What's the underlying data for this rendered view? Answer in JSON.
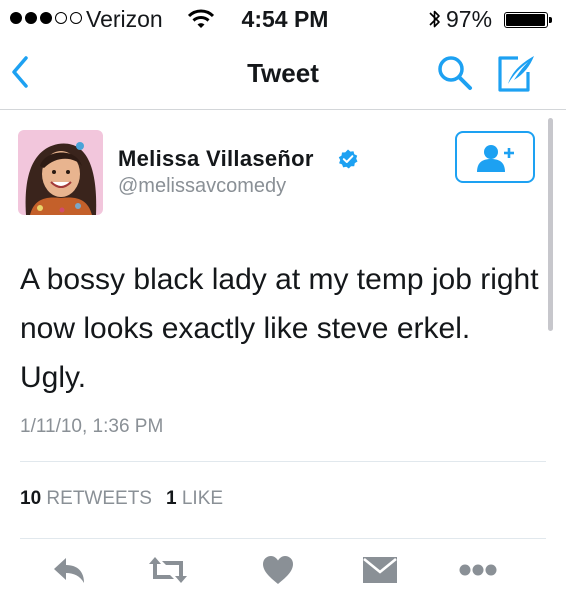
{
  "status_bar": {
    "carrier": "Verizon",
    "time": "4:54 PM",
    "battery_percent": "97%",
    "battery_level": 0.97,
    "signal_bars_filled": 3,
    "signal_bars_total": 5
  },
  "nav": {
    "title": "Tweet",
    "back_icon": "chevron-left-icon",
    "search_icon": "search-icon",
    "compose_icon": "compose-icon"
  },
  "tweet": {
    "author": {
      "display_name": "Melissa Villaseñor",
      "handle": "@melissavcomedy",
      "verified": true
    },
    "text": "A bossy black lady at my temp job right now looks exactly like steve erkel. Ugly.",
    "timestamp": "1/11/10, 1:36 PM",
    "stats": {
      "retweets_count": "10",
      "retweets_label": "RETWEETS",
      "likes_count": "1",
      "likes_label": "LIKE"
    }
  },
  "colors": {
    "accent": "#1da1f2",
    "text_primary": "#14171a",
    "text_secondary": "#8a9096",
    "icon_gray": "#8a9096"
  },
  "actions": [
    "reply-icon",
    "retweet-icon",
    "like-icon",
    "direct-message-icon",
    "more-icon"
  ]
}
